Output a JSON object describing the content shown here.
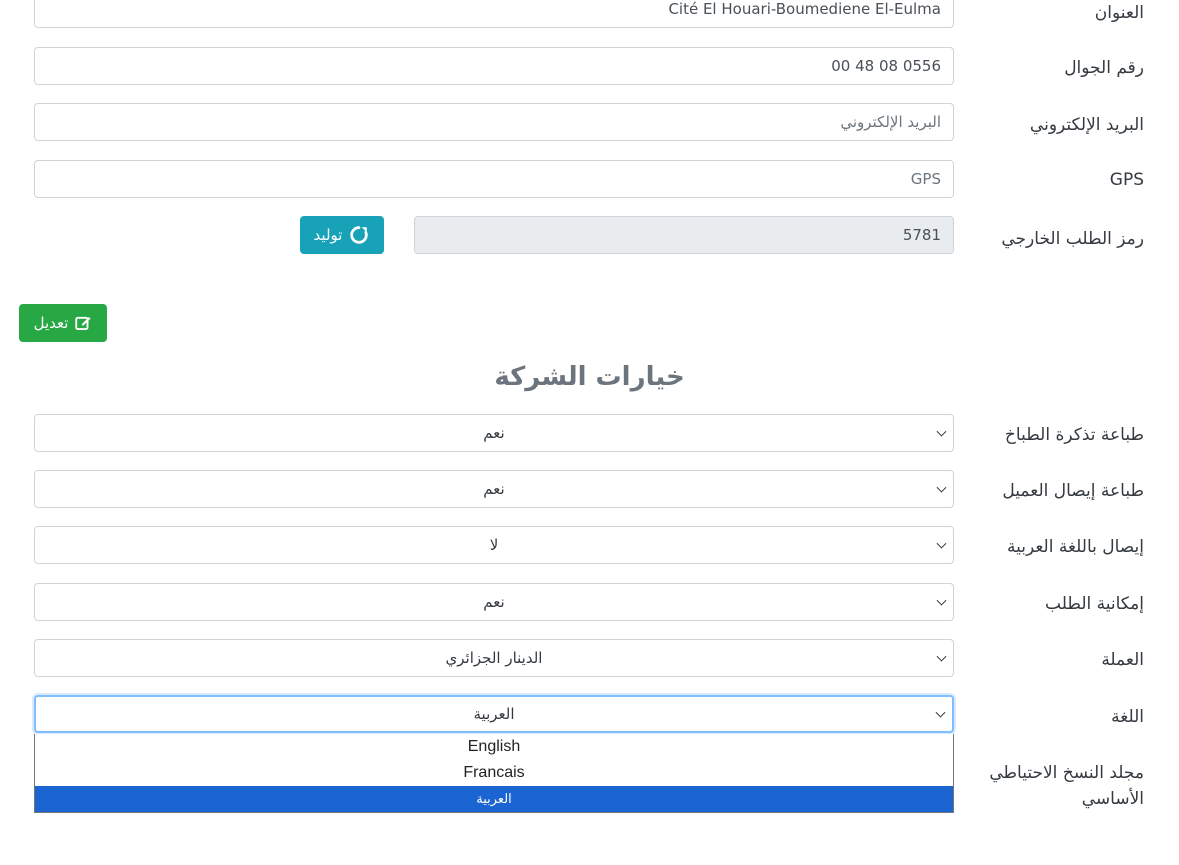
{
  "form": {
    "address": {
      "label": "العنوان",
      "value": "Cité El Houari-Boumediene El-Eulma"
    },
    "mobile": {
      "label": "رقم الجوال",
      "value": "00 48 08 0556"
    },
    "email": {
      "label": "البريد الإلكتروني",
      "placeholder": "البريد الإلكتروني"
    },
    "gps": {
      "label": "GPS",
      "placeholder": "GPS"
    },
    "external_code": {
      "label": "رمز الطلب الخارجي",
      "value": "5781"
    },
    "generate_button": "توليد",
    "edit_button": "تعديل"
  },
  "options": {
    "title": "خيارات الشركة",
    "rows": [
      {
        "label": "طباعة تذكرة الطباخ",
        "value": "نعم"
      },
      {
        "label": "طباعة إيصال العميل",
        "value": "نعم"
      },
      {
        "label": "إيصال باللغة العربية",
        "value": "لا"
      },
      {
        "label": "إمكانية الطلب",
        "value": "نعم"
      },
      {
        "label": "العملة",
        "value": "الدينار الجزائري"
      },
      {
        "label": "اللغة",
        "value": "العربية"
      }
    ],
    "backup_label_line1": "مجلد النسخ الاحتياطي",
    "backup_label_line2": "الأساسي",
    "language_options": [
      "English",
      "Francais",
      "العربية"
    ]
  },
  "colors": {
    "info": "#17a2b8",
    "success": "#28a745",
    "selected_option": "#1a65d1",
    "focus_border": "#80bdff"
  },
  "icons": {
    "generate": "refresh-icon",
    "edit": "edit-icon",
    "select_arrow": "chevron-down-icon"
  }
}
